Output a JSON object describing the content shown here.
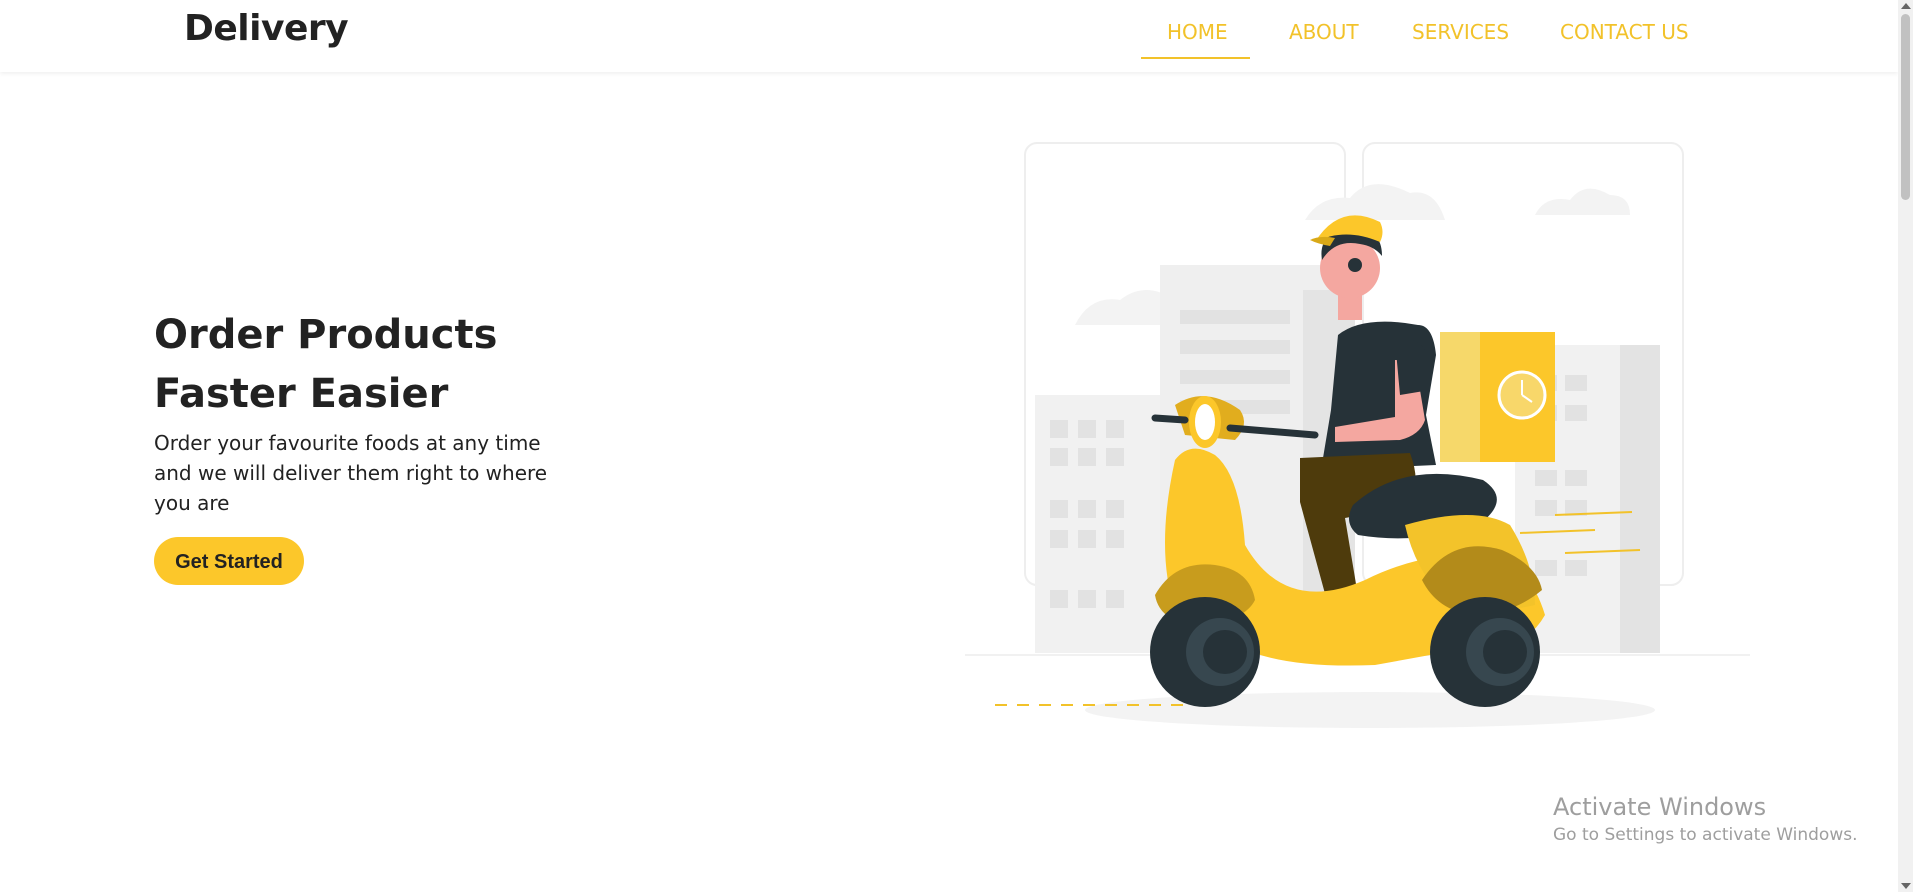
{
  "navbar": {
    "brand": "Delivery",
    "links": [
      {
        "label": "HOME",
        "active": true
      },
      {
        "label": "ABOUT"
      },
      {
        "label": "SERVICES"
      },
      {
        "label": "CONTACT US"
      }
    ]
  },
  "hero": {
    "title_line1": "Order Products",
    "title_line2": "Faster Easier",
    "description": "Order your favourite foods at any time and we will deliver them right to where you are",
    "cta_label": "Get Started"
  },
  "illustration": {
    "icon": "delivery-scooter-illustration",
    "accent": "#fcc72a",
    "dark": "#263238",
    "skin": "#f4a7a0"
  },
  "watermark": {
    "title": "Activate Windows",
    "subtitle": "Go to Settings to activate Windows."
  }
}
